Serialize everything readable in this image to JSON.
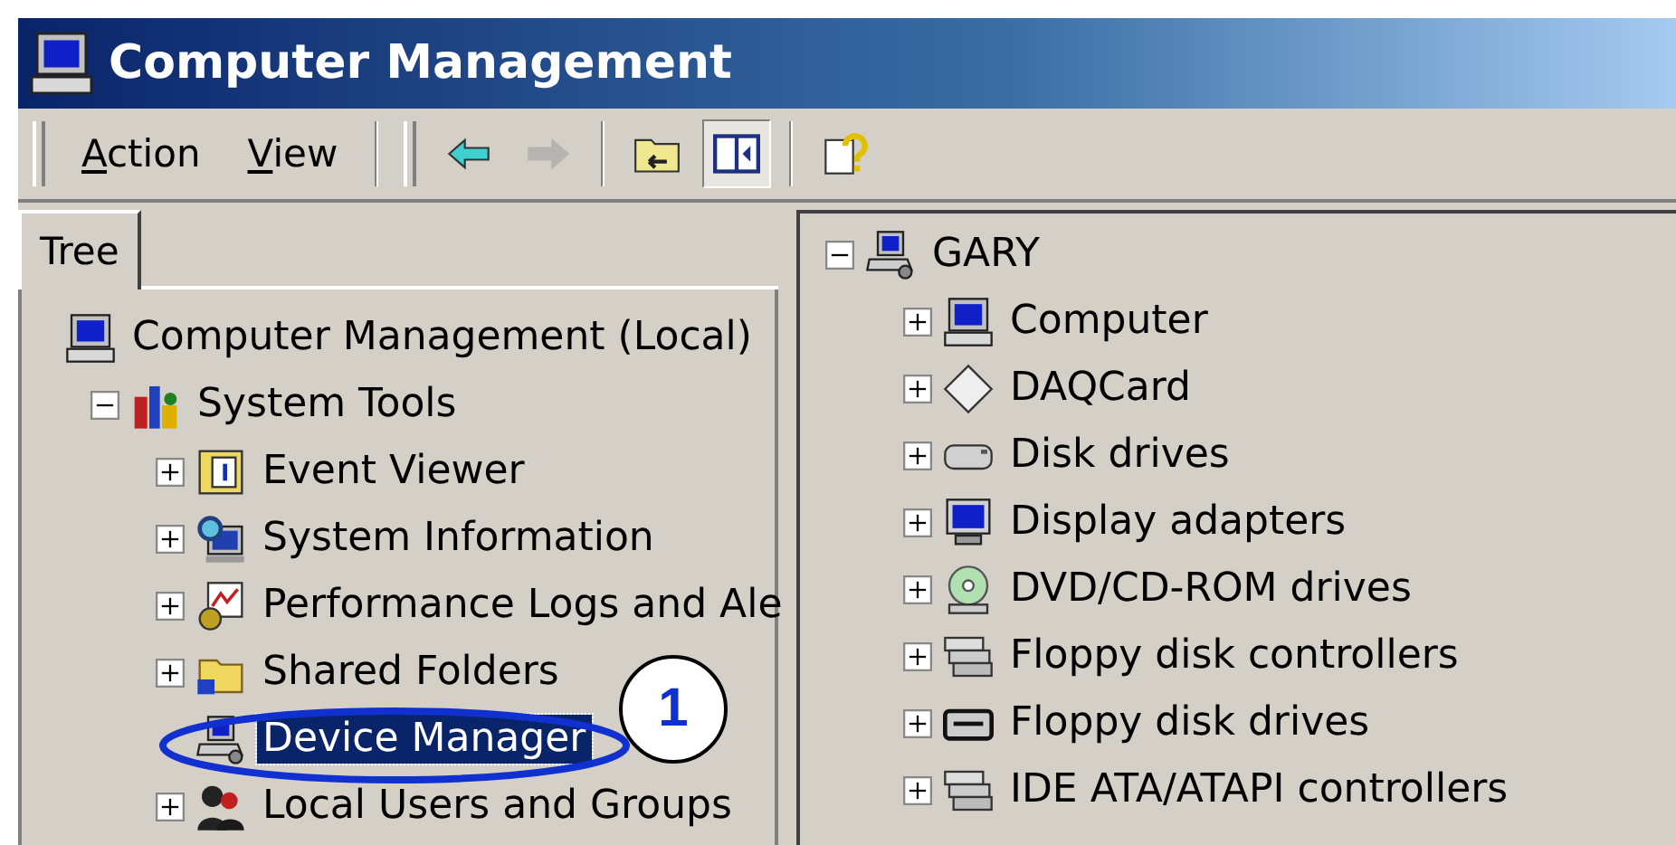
{
  "window": {
    "title": "Computer Management"
  },
  "menu": [
    {
      "label": "Action"
    },
    {
      "label": "View"
    }
  ],
  "toolbar": [
    {
      "kind": "back",
      "disabled": false,
      "pressed": false
    },
    {
      "kind": "forward",
      "disabled": true,
      "pressed": false
    },
    {
      "kind": "up-folder",
      "disabled": false,
      "pressed": false
    },
    {
      "kind": "tree-toggle",
      "disabled": false,
      "pressed": true
    },
    {
      "kind": "help",
      "disabled": false,
      "pressed": false
    }
  ],
  "tabs": [
    {
      "label": "Tree",
      "selected": true
    }
  ],
  "tree": {
    "nodes": [
      {
        "label": "Computer Management (Local)",
        "kind": "computer",
        "selected": false,
        "children": [
          {
            "label": "System Tools",
            "kind": "tools",
            "expanded": true,
            "selected": false,
            "children": [
              {
                "label": "Event Viewer",
                "kind": "event-log",
                "expanded": false,
                "selected": false
              },
              {
                "label": "System Information",
                "kind": "sysinfo",
                "expanded": false,
                "selected": false
              },
              {
                "label": "Performance Logs and Ale",
                "kind": "perf",
                "expanded": false,
                "selected": false
              },
              {
                "label": "Shared Folders",
                "kind": "folder",
                "expanded": false,
                "selected": false
              },
              {
                "label": "Device Manager",
                "kind": "device-manager",
                "selected": true
              },
              {
                "label": "Local Users and Groups",
                "kind": "users",
                "expanded": false,
                "selected": false
              }
            ]
          }
        ]
      }
    ]
  },
  "devices": {
    "nodes": [
      {
        "label": "GARY",
        "kind": "device-manager",
        "expanded": true,
        "children": [
          {
            "label": "Computer",
            "kind": "computer",
            "expanded": false
          },
          {
            "label": "DAQCard",
            "kind": "diamond",
            "expanded": false
          },
          {
            "label": "Disk drives",
            "kind": "disk",
            "expanded": false
          },
          {
            "label": "Display adapters",
            "kind": "monitor",
            "expanded": false
          },
          {
            "label": "DVD/CD-ROM drives",
            "kind": "cdrom",
            "expanded": false
          },
          {
            "label": "Floppy disk controllers",
            "kind": "controller",
            "expanded": false
          },
          {
            "label": "Floppy disk drives",
            "kind": "floppy",
            "expanded": false
          },
          {
            "label": "IDE ATA/ATAPI controllers",
            "kind": "controller",
            "expanded": false
          }
        ]
      }
    ]
  },
  "annotation": {
    "label": "1"
  }
}
